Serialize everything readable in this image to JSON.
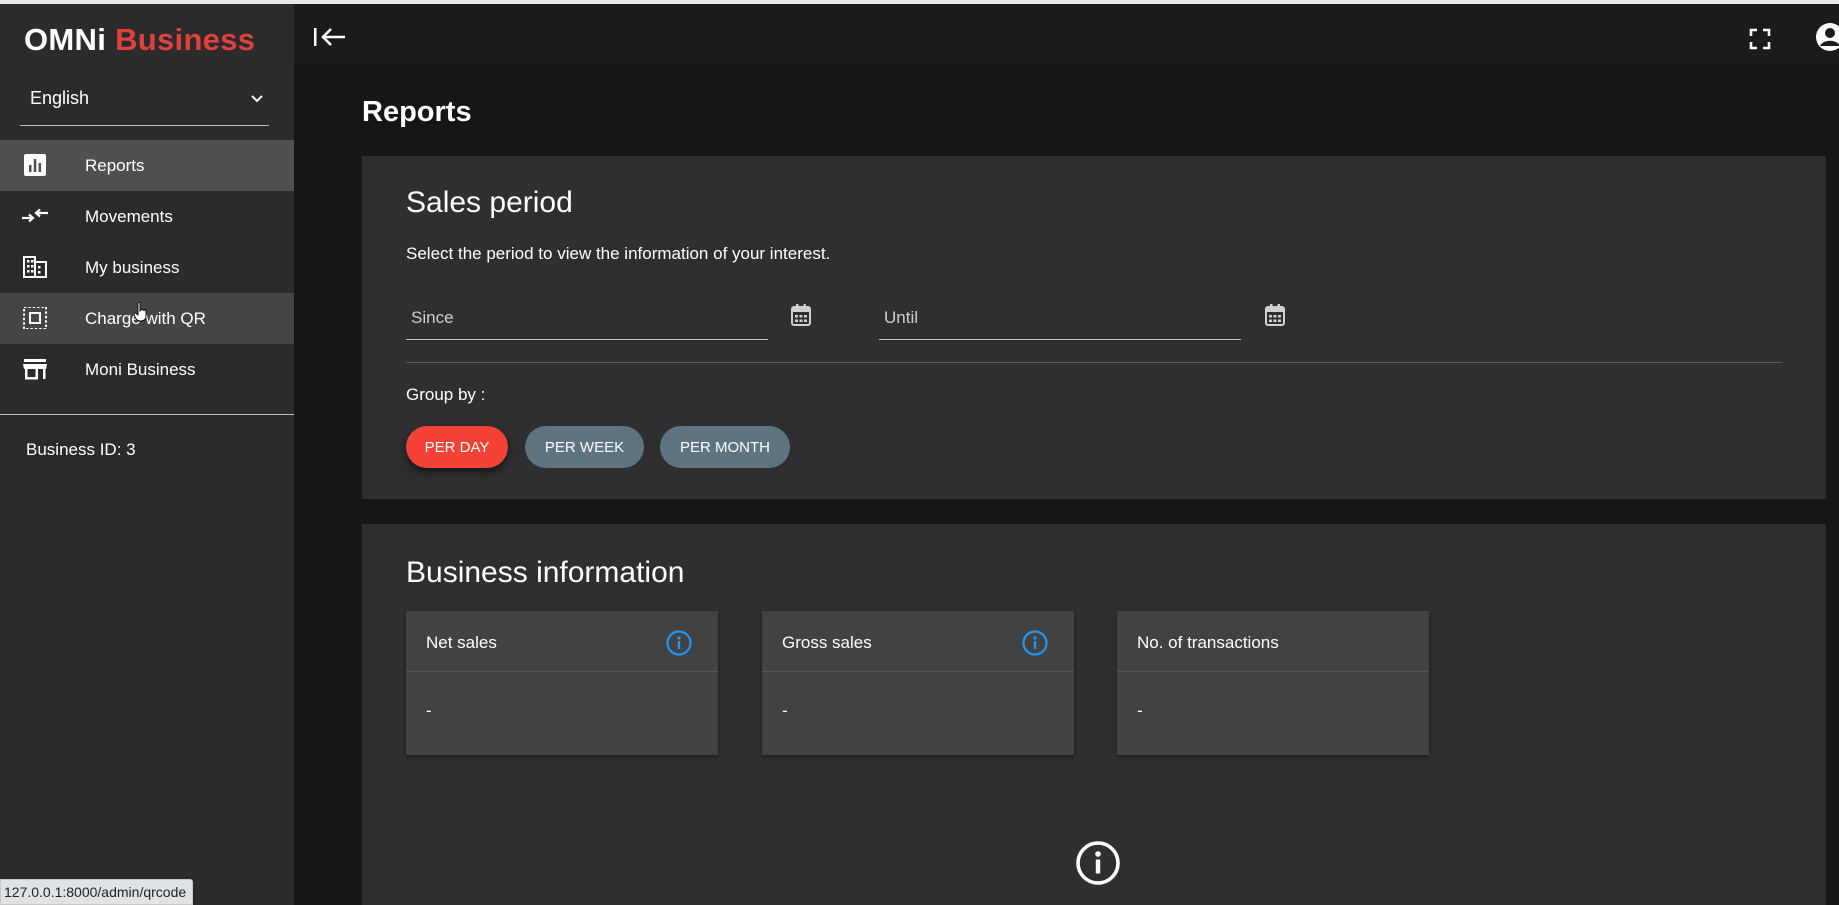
{
  "app": {
    "logo_part1": "OMNi",
    "logo_part2": "Business",
    "brand_red": "#e0413a"
  },
  "sidebar": {
    "language": "English",
    "items": [
      {
        "label": "Reports",
        "icon": "bar-chart-icon",
        "state": "active"
      },
      {
        "label": "Movements",
        "icon": "swap-arrows-icon",
        "state": "normal"
      },
      {
        "label": "My business",
        "icon": "building-icon",
        "state": "normal"
      },
      {
        "label": "Charge with QR",
        "icon": "qr-scan-icon",
        "state": "hover"
      },
      {
        "label": "Moni Business",
        "icon": "store-icon",
        "state": "normal"
      }
    ],
    "business_id": "Business ID: 3"
  },
  "topbar": {
    "collapse_icon": "collapse-left-icon",
    "fullscreen_icon": "fullscreen-icon",
    "account_icon": "account-icon"
  },
  "page": {
    "title": "Reports"
  },
  "sales_period": {
    "title": "Sales period",
    "subtitle": "Select the period to view the information of your interest.",
    "since_placeholder": "Since",
    "until_placeholder": "Until",
    "group_by_label": "Group by :",
    "groups": [
      {
        "label": "PER DAY",
        "selected": true
      },
      {
        "label": "PER WEEK",
        "selected": false
      },
      {
        "label": "PER MONTH",
        "selected": false
      }
    ],
    "selected_color": "#f44336",
    "unselected_color": "#5f7480"
  },
  "business_info": {
    "title": "Business information",
    "metrics": [
      {
        "title": "Net sales",
        "value": "-",
        "has_info": true
      },
      {
        "title": "Gross sales",
        "value": "-",
        "has_info": true
      },
      {
        "title": "No. of transactions",
        "value": "-",
        "has_info": false
      }
    ],
    "info_color": "#2196f3"
  },
  "status_bar": {
    "url": "127.0.0.1:8000/admin/qrcode"
  }
}
